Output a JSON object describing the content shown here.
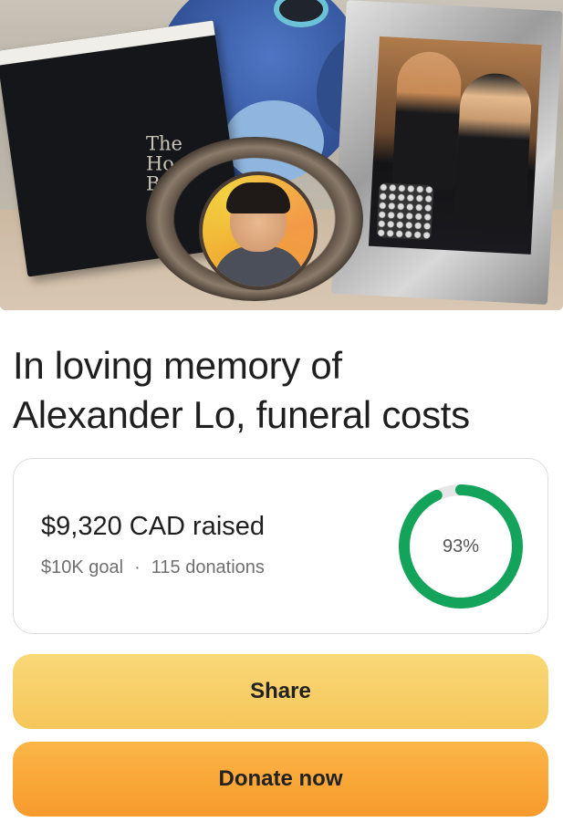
{
  "hero": {
    "image_name": "memorial-photo",
    "book_text": "The Holy Bible"
  },
  "fundraiser": {
    "title_line1": "In loving memory of",
    "title_line2": "Alexander Lo, funeral costs"
  },
  "progress": {
    "raised_text": "$9,320 CAD raised",
    "goal_text": "$10K goal",
    "separator": "·",
    "donations_text": "115 donations",
    "percent_text": "93%",
    "percent_value": 0.93,
    "ring_color": "#13a35a",
    "ring_track_color": "#e6e6e6"
  },
  "actions": {
    "share_label": "Share",
    "donate_label": "Donate now"
  }
}
